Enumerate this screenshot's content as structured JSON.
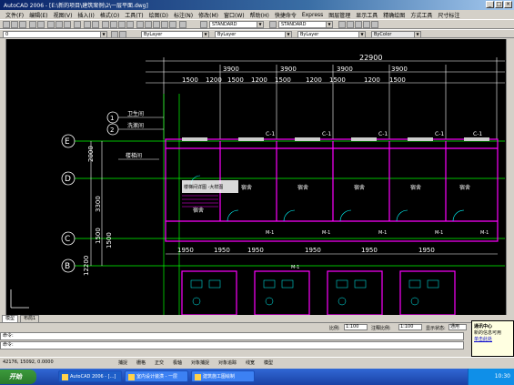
{
  "titlebar": {
    "title": "AutoCAD 2006 - [E:\\新的项目\\建筑案例\\2\\一层平面.dwg]"
  },
  "menu": [
    "文件(F)",
    "编辑(E)",
    "视图(V)",
    "插入(I)",
    "格式(O)",
    "工具(T)",
    "绘图(D)",
    "标注(N)",
    "修改(M)",
    "窗口(W)",
    "帮助(H)",
    "快捷命令",
    "Express",
    "图层管理",
    "显示工具",
    "精确绘图",
    "方式工具",
    "尺寸标注"
  ],
  "toolbar2": {
    "layer_value": "0",
    "color_value": "ByLayer",
    "linetype_value": "ByLayer",
    "lineweight_value": "ByLayer",
    "plotstyle_value": "ByColor",
    "textstyle_value": "STANDARD",
    "dimstyle_value": "STANDARD"
  },
  "drawing": {
    "dim_total": "22900",
    "dims_top": [
      "3900",
      "3900",
      "3900",
      "3900"
    ],
    "dims_sub": [
      "1500",
      "1200",
      "1500",
      "1200",
      "1500",
      "1200",
      "1500",
      "1200",
      "1500"
    ],
    "dims_bottom": [
      "1950",
      "1950",
      "1950",
      "1950",
      "1950",
      "1950"
    ],
    "dims_left": [
      "2000",
      "3300",
      "1500",
      "12200",
      "1500"
    ],
    "axes_left": [
      "E",
      "D",
      "C",
      "B"
    ],
    "axes_top": [
      "1",
      "2"
    ],
    "window_tags": [
      "C-1",
      "C-1",
      "C-1",
      "C-1",
      "C-1"
    ],
    "door_tags": [
      "M-1",
      "M-1",
      "M-1",
      "M-1",
      "M-1",
      "M-1"
    ],
    "room_labels": [
      "宿舍",
      "宿舍",
      "宿舍",
      "宿舍",
      "宿舍",
      "宿舍"
    ],
    "callouts": [
      "卫生间",
      "洗漱间",
      "楼梯间",
      "楼梯间详图 -大样图"
    ]
  },
  "layout_tabs": [
    "模型",
    "布局1"
  ],
  "command": {
    "history": "命令:",
    "prompt": "命令:"
  },
  "scale_controls": {
    "label1": "比例:",
    "value1": "1:100",
    "label2": "注释比例:",
    "value2": "1:100",
    "label3": "显示状态:",
    "value3": "通用"
  },
  "status": {
    "coords": "42176, 15092, 0.0000",
    "toggles": [
      "捕捉",
      "栅格",
      "正交",
      "极轴",
      "对象捕捉",
      "对象追踪",
      "线宽",
      "模型"
    ]
  },
  "popup": {
    "title": "通讯中心",
    "body": "新的信息可用",
    "link": "单击此处"
  },
  "taskbar": {
    "start_label": "开始",
    "tasks": [
      "AutoCAD 2006 - [...]",
      "室内设计装潢 - 一层",
      "建筑施工图绘制"
    ],
    "clock": "10:30"
  },
  "colors": {
    "canvas_bg": "#000000",
    "axis_line": "#00ff00",
    "wall": "#ff00ff",
    "window": "#ffffff",
    "dim": "#ffffff"
  }
}
